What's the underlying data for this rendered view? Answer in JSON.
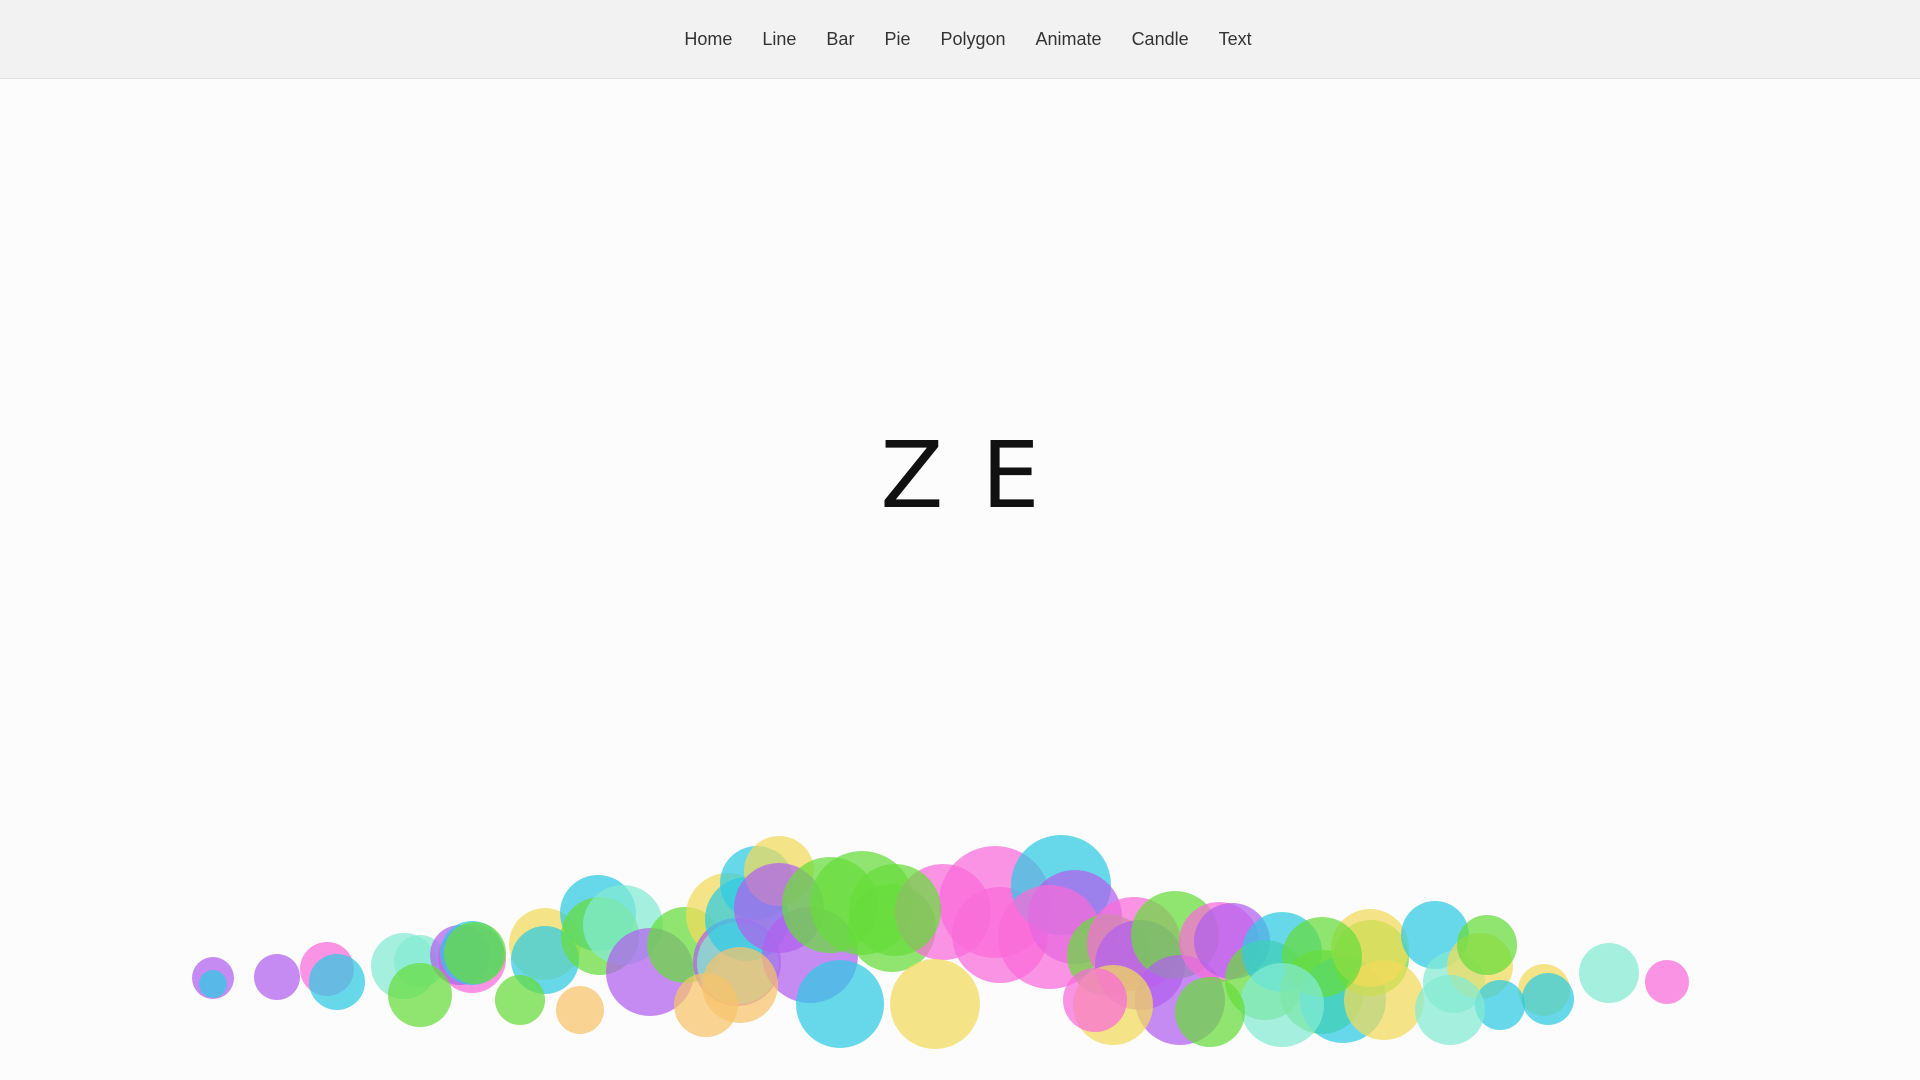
{
  "nav": {
    "items": [
      {
        "label": "Home"
      },
      {
        "label": "Line"
      },
      {
        "label": "Bar"
      },
      {
        "label": "Pie"
      },
      {
        "label": "Polygon"
      },
      {
        "label": "Animate"
      },
      {
        "label": "Candle"
      },
      {
        "label": "Text"
      }
    ]
  },
  "hero": {
    "text": "ZE"
  },
  "colors": {
    "navbar_bg": "#f2f2f2",
    "page_bg": "#fcfcfc",
    "bubble_palette": [
      "#2ecbe3",
      "#f2db5a",
      "#84ead3",
      "#66dc3c",
      "#b25fef",
      "#f96bd9",
      "#f7c36a"
    ]
  }
}
